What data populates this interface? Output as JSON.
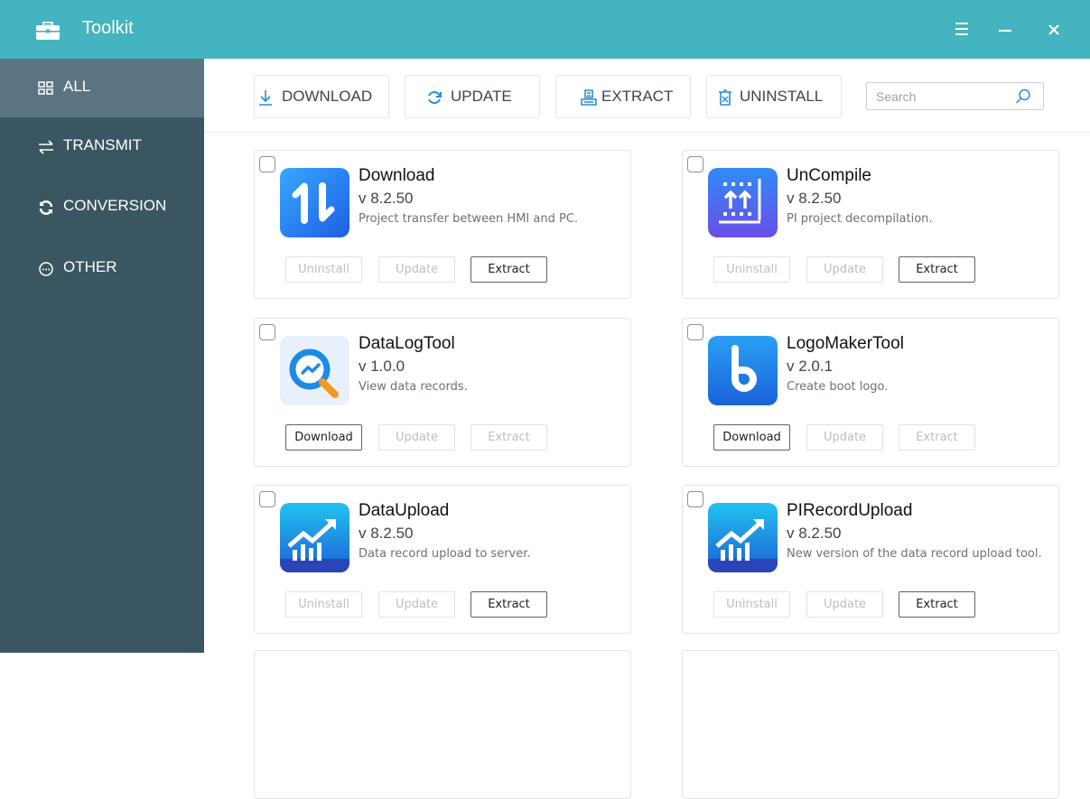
{
  "window": {
    "title": "Toolkit"
  },
  "sidebar": {
    "items": [
      {
        "label": "ALL",
        "active": true
      },
      {
        "label": "TRANSMIT",
        "active": false
      },
      {
        "label": "CONVERSION",
        "active": false
      },
      {
        "label": "OTHER",
        "active": false
      }
    ]
  },
  "toolbar": {
    "download_label": "DOWNLOAD",
    "update_label": "UPDATE",
    "extract_label": "EXTRACT",
    "uninstall_label": "UNINSTALL",
    "search_placeholder": "Search",
    "search_value": ""
  },
  "cards": [
    {
      "name": "Download",
      "version": "v 8.2.50",
      "description": "Project transfer between HMI and PC.",
      "btn1": "Uninstall",
      "btn1_enabled": false,
      "btn2": "Update",
      "btn2_enabled": false,
      "btn3": "Extract",
      "btn3_enabled": true,
      "checked": false
    },
    {
      "name": "UnCompile",
      "version": "v 8.2.50",
      "description": "PI project decompilation.",
      "btn1": "Uninstall",
      "btn1_enabled": false,
      "btn2": "Update",
      "btn2_enabled": false,
      "btn3": "Extract",
      "btn3_enabled": true,
      "checked": false
    },
    {
      "name": "DataLogTool",
      "version": "v 1.0.0",
      "description": "View data records.",
      "btn1": "Download",
      "btn1_enabled": true,
      "btn2": "Update",
      "btn2_enabled": false,
      "btn3": "Extract",
      "btn3_enabled": false,
      "checked": false
    },
    {
      "name": "LogoMakerTool",
      "version": "v 2.0.1",
      "description": "Create boot logo.",
      "btn1": "Download",
      "btn1_enabled": true,
      "btn2": "Update",
      "btn2_enabled": false,
      "btn3": "Extract",
      "btn3_enabled": false,
      "checked": false
    },
    {
      "name": "DataUpload",
      "version": "v 8.2.50",
      "description": "Data record upload to server.",
      "btn1": "Uninstall",
      "btn1_enabled": false,
      "btn2": "Update",
      "btn2_enabled": false,
      "btn3": "Extract",
      "btn3_enabled": true,
      "checked": false
    },
    {
      "name": "PIRecordUpload",
      "version": "v 8.2.50",
      "description": "New version of the data record upload tool.",
      "btn1": "Uninstall",
      "btn1_enabled": false,
      "btn2": "Update",
      "btn2_enabled": false,
      "btn3": "Extract",
      "btn3_enabled": true,
      "checked": false
    }
  ],
  "colors": {
    "titlebar": "#44b4c0",
    "sidebar": "#3a5663",
    "sidebar_active": "#5a7581"
  },
  "icons": [
    "toolbox-icon",
    "menu-icon",
    "minimize-icon",
    "close-icon",
    "grid-icon",
    "transfer-arrows-icon",
    "refresh-icon",
    "more-circle-icon",
    "download-icon",
    "update-icon",
    "extract-icon",
    "uninstall-icon",
    "search-icon"
  ]
}
